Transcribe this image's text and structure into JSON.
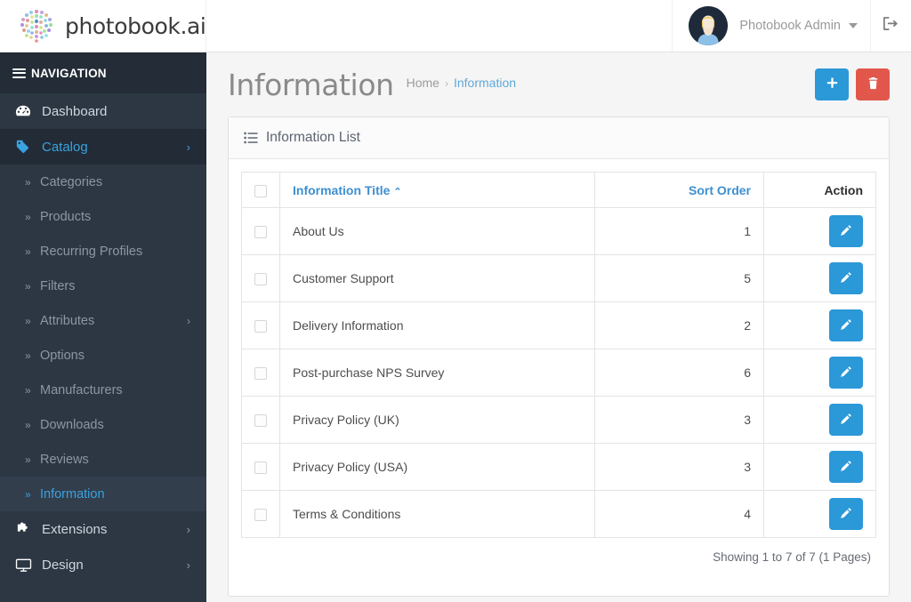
{
  "brand": {
    "name": "photobook.ai",
    "logo_icon": "brain-dots-logo"
  },
  "topbar": {
    "user_name": "Photobook Admin",
    "user_caret_icon": "chevron-down-icon",
    "avatar_icon": "user-avatar",
    "logout_icon": "sign-out-icon"
  },
  "sidebar": {
    "header": "NAVIGATION",
    "header_icon": "hamburger-icon",
    "items": [
      {
        "label": "Dashboard",
        "icon": "tachometer-icon",
        "type": "top",
        "active": false,
        "chevron": ""
      },
      {
        "label": "Catalog",
        "icon": "tag-icon",
        "type": "top",
        "active": true,
        "chevron": "›"
      },
      {
        "label": "Categories",
        "icon": "angle-double-right-icon",
        "type": "sub",
        "active": false,
        "chevron": ""
      },
      {
        "label": "Products",
        "icon": "angle-double-right-icon",
        "type": "sub",
        "active": false,
        "chevron": ""
      },
      {
        "label": "Recurring Profiles",
        "icon": "angle-double-right-icon",
        "type": "sub",
        "active": false,
        "chevron": ""
      },
      {
        "label": "Filters",
        "icon": "angle-double-right-icon",
        "type": "sub",
        "active": false,
        "chevron": ""
      },
      {
        "label": "Attributes",
        "icon": "angle-double-right-icon",
        "type": "sub",
        "active": false,
        "chevron": "›"
      },
      {
        "label": "Options",
        "icon": "angle-double-right-icon",
        "type": "sub",
        "active": false,
        "chevron": ""
      },
      {
        "label": "Manufacturers",
        "icon": "angle-double-right-icon",
        "type": "sub",
        "active": false,
        "chevron": ""
      },
      {
        "label": "Downloads",
        "icon": "angle-double-right-icon",
        "type": "sub",
        "active": false,
        "chevron": ""
      },
      {
        "label": "Reviews",
        "icon": "angle-double-right-icon",
        "type": "sub",
        "active": false,
        "chevron": ""
      },
      {
        "label": "Information",
        "icon": "angle-double-right-icon",
        "type": "sub",
        "active": true,
        "chevron": ""
      },
      {
        "label": "Extensions",
        "icon": "puzzle-piece-icon",
        "type": "top",
        "active": false,
        "chevron": "›"
      },
      {
        "label": "Design",
        "icon": "desktop-icon",
        "type": "top",
        "active": false,
        "chevron": "›"
      }
    ]
  },
  "page": {
    "title": "Information",
    "breadcrumb": [
      {
        "label": "Home",
        "current": false
      },
      {
        "label": "Information",
        "current": true
      }
    ],
    "breadcrumb_separator": "›",
    "actions": [
      {
        "name": "add-new-button",
        "icon": "plus-icon",
        "color": "#2b98d8"
      },
      {
        "name": "delete-button",
        "icon": "trash-icon",
        "color": "#e2574c"
      }
    ]
  },
  "panel": {
    "title": "Information List",
    "title_icon": "list-icon"
  },
  "table": {
    "select_all_label": "",
    "columns": [
      {
        "key": "check",
        "label": "",
        "sortable": false,
        "align": "center"
      },
      {
        "key": "title",
        "label": "Information Title",
        "sortable": true,
        "align": "left",
        "sort_dir": "asc",
        "sort_caret": "⌃"
      },
      {
        "key": "sort",
        "label": "Sort Order",
        "sortable": true,
        "align": "right"
      },
      {
        "key": "action",
        "label": "Action",
        "sortable": false,
        "align": "right"
      }
    ],
    "rows": [
      {
        "title": "About Us",
        "sort_order": "1",
        "action_icon": "pencil-icon"
      },
      {
        "title": "Customer Support",
        "sort_order": "5",
        "action_icon": "pencil-icon"
      },
      {
        "title": "Delivery Information",
        "sort_order": "2",
        "action_icon": "pencil-icon"
      },
      {
        "title": "Post-purchase NPS Survey",
        "sort_order": "6",
        "action_icon": "pencil-icon"
      },
      {
        "title": "Privacy Policy (UK)",
        "sort_order": "3",
        "action_icon": "pencil-icon"
      },
      {
        "title": "Privacy Policy (USA)",
        "sort_order": "3",
        "action_icon": "pencil-icon"
      },
      {
        "title": "Terms & Conditions",
        "sort_order": "4",
        "action_icon": "pencil-icon"
      }
    ],
    "footer_text": "Showing 1 to 7 of 7 (1 Pages)"
  },
  "colors": {
    "sidebar_bg": "#2c3743",
    "sidebar_header_bg": "#232c37",
    "sidebar_active_bg": "#222b36",
    "sidebar_sub_active_bg": "#323e4c",
    "accent_blue": "#2b98d8",
    "link_blue": "#3d8fd1",
    "danger_red": "#e2574c",
    "content_bg": "#f5f5f5"
  }
}
